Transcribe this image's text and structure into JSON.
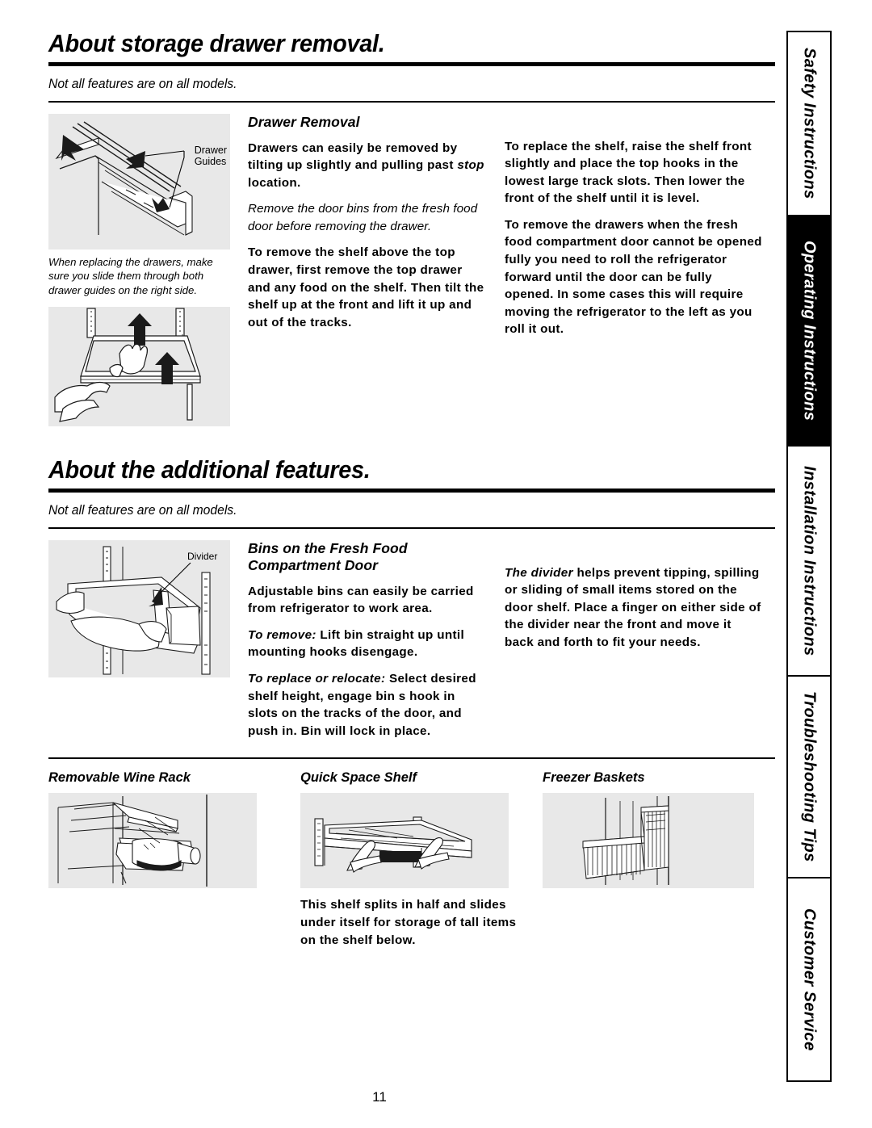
{
  "page": {
    "number": "11"
  },
  "sections": [
    {
      "title": "About storage drawer removal.",
      "note": "Not all features are on all models.",
      "heading": "Drawer Removal",
      "figure_label": "Drawer\nGuides",
      "figure_caption": "When replacing the drawers, make sure you slide them through both drawer guides on the right side.",
      "col_a": [
        {
          "style": "bold",
          "text": "Drawers can easily be removed by tilting up slightly and pulling past ",
          "emph": "stop",
          "tail": " location."
        },
        {
          "style": "italic",
          "text": "Remove the door bins from the fresh food door before removing the drawer."
        },
        {
          "style": "bold",
          "text": "To remove the shelf above the top drawer, first remove the top drawer and any food on the shelf. Then tilt the shelf up at the front and lift it up and out of the tracks."
        }
      ],
      "col_b": [
        {
          "style": "bold",
          "text": "To replace the shelf, raise the shelf front slightly and place the top hooks in the lowest large track slots. Then lower the front of the shelf until it is level."
        },
        {
          "style": "bold",
          "text": "To remove the drawers when the fresh food compartment door cannot be opened fully you need to roll the refrigerator forward until the door can be fully opened. In some cases this will require moving the refrigerator to the left as you roll it out."
        }
      ]
    },
    {
      "title": "About the additional features.",
      "note": "Not all features are on all models.",
      "heading": "Bins on the Fresh Food Compartment Door",
      "figure_label": "Divider",
      "col_a": [
        {
          "style": "bold",
          "text": "Adjustable bins can easily be carried from refrigerator to work area."
        },
        {
          "lead": "To remove:",
          "style": "bold",
          "text": " Lift bin straight up until mounting hooks disengage."
        },
        {
          "lead": "To replace or relocate:",
          "style": "bold",
          "text": " Select desired shelf height, engage bin s hook in slots on the tracks of the door, and push in. Bin will lock in place."
        }
      ],
      "col_b": [
        {
          "lead": "The divider",
          "style": "bold",
          "text": " helps prevent tipping, spilling or sliding of small items stored on the door shelf. Place a finger on either side of the divider near the front and move it back and forth to fit your needs."
        }
      ]
    }
  ],
  "trio": [
    {
      "heading": "Removable Wine Rack",
      "body": ""
    },
    {
      "heading": "Quick Space Shelf",
      "body": "This shelf splits in half and slides under itself for storage of tall items on the shelf below."
    },
    {
      "heading": "Freezer Baskets",
      "body": ""
    }
  ],
  "rail": {
    "tabs": [
      {
        "label": "Safety Instructions",
        "active": false
      },
      {
        "label": "Operating Instructions",
        "active": true
      },
      {
        "label": "Installation Instructions",
        "active": false
      },
      {
        "label": "Troubleshooting Tips",
        "active": false
      },
      {
        "label": "Customer Service",
        "active": false
      }
    ]
  },
  "colors": {
    "figure_background": "#e8e8e8",
    "ink": "#000000",
    "active_tab_text": "#ffffff"
  }
}
